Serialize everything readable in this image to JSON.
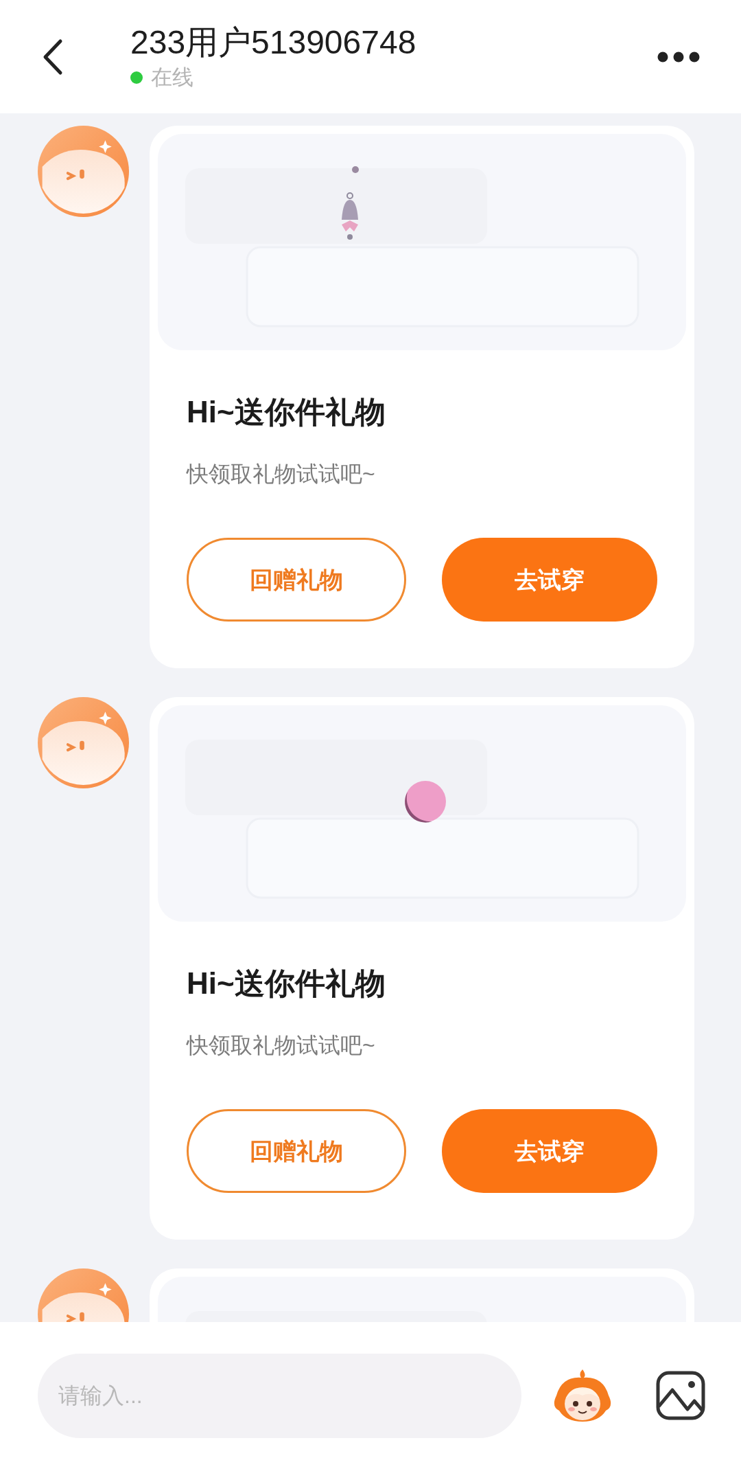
{
  "header": {
    "title": "233用户513906748",
    "status": "在线",
    "online": true
  },
  "messages": [
    {
      "image": {
        "kind": "picture"
      },
      "title": "Hi~送你件礼物",
      "subtitle": "快领取礼物试试吧~",
      "buttons": [
        {
          "label": "回赠礼物",
          "kind": "outline"
        },
        {
          "label": "去试穿",
          "kind": "filled"
        }
      ]
    },
    {
      "image": {
        "kind": "picture"
      },
      "title": "Hi~送你件礼物",
      "subtitle": "快领取礼物试试吧~",
      "buttons": [
        {
          "label": "回赠礼物",
          "kind": "outline"
        },
        {
          "label": "去试穿",
          "kind": "filled"
        }
      ]
    },
    {
      "image": {
        "kind": "picture"
      }
    }
  ],
  "composer": {
    "placeholder": "请输入..."
  }
}
